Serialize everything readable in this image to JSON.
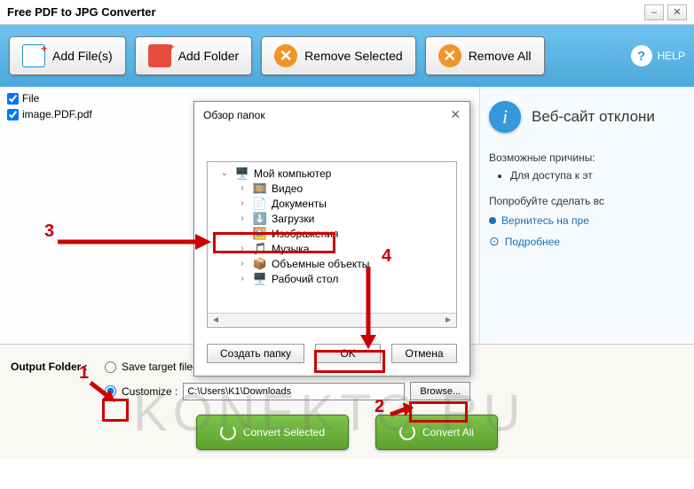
{
  "window": {
    "title": "Free PDF to JPG Converter"
  },
  "toolbar": {
    "add_file": "Add File(s)",
    "add_folder": "Add Folder",
    "remove_selected": "Remove Selected",
    "remove_all": "Remove All",
    "help": "HELP"
  },
  "files": {
    "header": "File",
    "items": [
      "image.PDF.pdf"
    ]
  },
  "sidepanel": {
    "title": "Веб-сайт отклони",
    "reasons_label": "Возможные причины:",
    "reasons": [
      "Для доступа к эт"
    ],
    "try_label": "Попробуйте сделать вс",
    "try_items": [
      "Вернитесь на пре"
    ],
    "more": "Подробнее"
  },
  "output": {
    "label": "Output Folder :",
    "opt_source": "Save target file(s) in source folder",
    "opt_custom": "Customize :",
    "path": "C:\\Users\\K1\\Downloads",
    "browse": "Browse...",
    "convert_selected": "Convert Selected",
    "convert_all": "Convert All"
  },
  "dialog": {
    "title": "Обзор папок",
    "ok": "OK",
    "cancel": "Отмена",
    "create": "Создать папку",
    "tree": {
      "root": "Мой компьютер",
      "children": [
        "Видео",
        "Документы",
        "Загрузки",
        "Изображения",
        "Музыка",
        "Объемные объекты",
        "Рабочий стол"
      ],
      "selected": "Загрузки"
    }
  },
  "annotations": {
    "n1": "1",
    "n2": "2",
    "n3": "3",
    "n4": "4"
  },
  "watermark": "KONEKTO.RU"
}
